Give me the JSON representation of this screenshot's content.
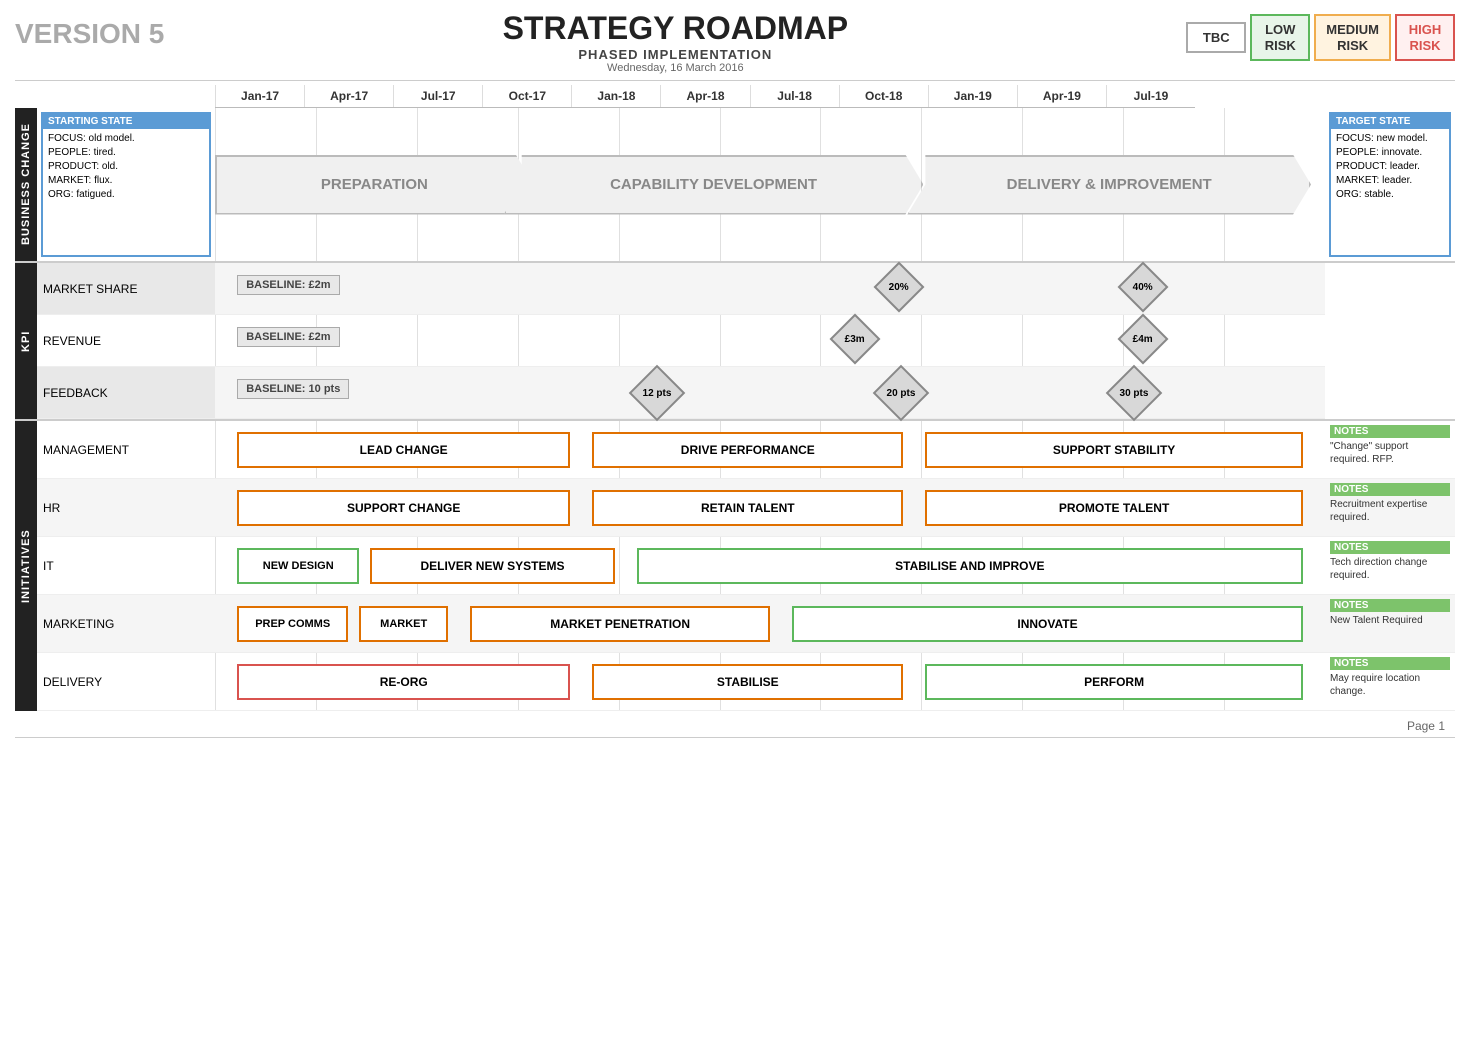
{
  "header": {
    "version": "VERSION 5",
    "title": "STRATEGY ROADMAP",
    "subtitle": "PHASED IMPLEMENTATION",
    "date": "Wednesday, 16 March 2016",
    "risk_badges": [
      {
        "label": "TBC",
        "class": "risk-tbc"
      },
      {
        "label": "LOW\nRISK",
        "class": "risk-low"
      },
      {
        "label": "MEDIUM\nRISK",
        "class": "risk-medium"
      },
      {
        "label": "HIGH\nRISK",
        "class": "risk-high"
      }
    ]
  },
  "timeline_cols": [
    "Jan-17",
    "Apr-17",
    "Jul-17",
    "Oct-17",
    "Jan-18",
    "Apr-18",
    "Jul-18",
    "Oct-18",
    "Jan-19",
    "Apr-19",
    "Jul-19"
  ],
  "business_change": {
    "section_label": "BUSINESS CHANGE",
    "starting_state": {
      "title": "STARTING STATE",
      "lines": [
        "FOCUS: old model.",
        "PEOPLE: tired.",
        "PRODUCT: old.",
        "MARKET: flux.",
        "ORG: fatigued."
      ]
    },
    "phases": [
      "PREPARATION",
      "CAPABILITY DEVELOPMENT",
      "DELIVERY & IMPROVEMENT"
    ],
    "target_state": {
      "title": "TARGET STATE",
      "lines": [
        "FOCUS: new model.",
        "PEOPLE: innovate.",
        "PRODUCT: leader.",
        "MARKET: leader.",
        "ORG: stable."
      ]
    }
  },
  "kpi": {
    "section_label": "KPI",
    "rows": [
      {
        "label": "MARKET SHARE",
        "baseline": "BASELINE: £2m",
        "baseline_left_pct": 4,
        "markers": [
          {
            "label": "20%",
            "left_pct": 60
          },
          {
            "label": "40%",
            "left_pct": 83
          }
        ]
      },
      {
        "label": "REVENUE",
        "baseline": "BASELINE: £2m",
        "baseline_left_pct": 4,
        "markers": [
          {
            "label": "£3m",
            "left_pct": 57
          },
          {
            "label": "£4m",
            "left_pct": 83
          }
        ]
      },
      {
        "label": "FEEDBACK",
        "baseline": "BASELINE: 10 pts",
        "baseline_left_pct": 4,
        "markers": [
          {
            "label": "12 pts",
            "left_pct": 40
          },
          {
            "label": "20 pts",
            "left_pct": 63
          },
          {
            "label": "30 pts",
            "left_pct": 83
          }
        ]
      }
    ]
  },
  "initiatives": {
    "section_label": "INITIATIVES",
    "rows": [
      {
        "label": "MANAGEMENT",
        "bars": [
          {
            "text": "LEAD CHANGE",
            "left_pct": 2,
            "width_pct": 32,
            "color": "orange"
          },
          {
            "text": "DRIVE PERFORMANCE",
            "left_pct": 36,
            "width_pct": 28,
            "color": "orange"
          },
          {
            "text": "SUPPORT STABILITY",
            "left_pct": 66,
            "width_pct": 32,
            "color": "orange"
          }
        ],
        "note_title": "NOTES",
        "note_body": "\"Change\" support required. RFP."
      },
      {
        "label": "HR",
        "bars": [
          {
            "text": "SUPPORT CHANGE",
            "left_pct": 2,
            "width_pct": 32,
            "color": "orange"
          },
          {
            "text": "RETAIN TALENT",
            "left_pct": 36,
            "width_pct": 28,
            "color": "orange"
          },
          {
            "text": "PROMOTE TALENT",
            "left_pct": 66,
            "width_pct": 32,
            "color": "orange"
          }
        ],
        "note_title": "NOTES",
        "note_body": "Recruitment expertise required."
      },
      {
        "label": "IT",
        "bars": [
          {
            "text": "NEW DESIGN",
            "left_pct": 2,
            "width_pct": 12,
            "color": "green"
          },
          {
            "text": "DELIVER NEW SYSTEMS",
            "left_pct": 15,
            "width_pct": 23,
            "color": "orange"
          },
          {
            "text": "STABILISE AND IMPROVE",
            "left_pct": 40,
            "width_pct": 58,
            "color": "green"
          }
        ],
        "note_title": "NOTES",
        "note_body": "Tech direction change required."
      },
      {
        "label": "MARKETING",
        "bars": [
          {
            "text": "PREP COMMS",
            "left_pct": 2,
            "width_pct": 12,
            "color": "orange"
          },
          {
            "text": "MARKET",
            "left_pct": 15,
            "width_pct": 10,
            "color": "orange"
          },
          {
            "text": "MARKET PENETRATION",
            "left_pct": 27,
            "width_pct": 28,
            "color": "orange"
          },
          {
            "text": "INNOVATE",
            "left_pct": 57,
            "width_pct": 41,
            "color": "green"
          }
        ],
        "note_title": "NOTES",
        "note_body": "New Talent Required"
      },
      {
        "label": "DELIVERY",
        "bars": [
          {
            "text": "RE-ORG",
            "left_pct": 2,
            "width_pct": 32,
            "color": "red"
          },
          {
            "text": "STABILISE",
            "left_pct": 36,
            "width_pct": 28,
            "color": "orange"
          },
          {
            "text": "PERFORM",
            "left_pct": 66,
            "width_pct": 32,
            "color": "green"
          }
        ],
        "note_title": "NOTES",
        "note_body": "May require location change."
      }
    ]
  },
  "page_number": "Page 1"
}
